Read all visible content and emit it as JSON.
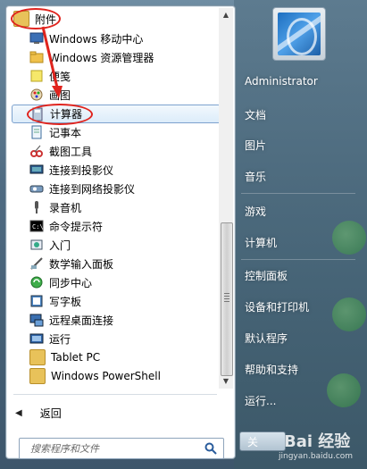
{
  "menu": {
    "folder_label": "附件",
    "items": [
      {
        "label": "Windows 移动中心",
        "icon": "mobility-center-icon"
      },
      {
        "label": "Windows 资源管理器",
        "icon": "explorer-icon"
      },
      {
        "label": "便笺",
        "icon": "sticky-notes-icon"
      },
      {
        "label": "画图",
        "icon": "paint-icon"
      },
      {
        "label": "计算器",
        "icon": "calculator-icon"
      },
      {
        "label": "记事本",
        "icon": "notepad-icon"
      },
      {
        "label": "截图工具",
        "icon": "snipping-tool-icon"
      },
      {
        "label": "连接到投影仪",
        "icon": "projector-icon"
      },
      {
        "label": "连接到网络投影仪",
        "icon": "network-projector-icon"
      },
      {
        "label": "录音机",
        "icon": "sound-recorder-icon"
      },
      {
        "label": "命令提示符",
        "icon": "command-prompt-icon"
      },
      {
        "label": "入门",
        "icon": "getting-started-icon"
      },
      {
        "label": "数学输入面板",
        "icon": "math-input-icon"
      },
      {
        "label": "同步中心",
        "icon": "sync-center-icon"
      },
      {
        "label": "写字板",
        "icon": "wordpad-icon"
      },
      {
        "label": "远程桌面连接",
        "icon": "remote-desktop-icon"
      },
      {
        "label": "运行",
        "icon": "run-icon"
      },
      {
        "label": "Tablet PC",
        "icon": "folder-icon"
      },
      {
        "label": "Windows PowerShell",
        "icon": "folder-icon"
      }
    ],
    "selected_label": "计算器",
    "back_label": "返回",
    "search_placeholder": "搜索程序和文件"
  },
  "right": {
    "links": [
      "Administrator",
      "文档",
      "图片",
      "音乐",
      "游戏",
      "计算机",
      "控制面板",
      "设备和打印机",
      "默认程序",
      "帮助和支持",
      "运行..."
    ],
    "shutdown_label": "关"
  },
  "watermark": {
    "brand": "Bai 经验",
    "url": "jingyan.baidu.com"
  },
  "colors": {
    "annotation_red": "#e0241e",
    "selection_border": "#7da2ce",
    "folder_yellow": "#e8c25a"
  }
}
